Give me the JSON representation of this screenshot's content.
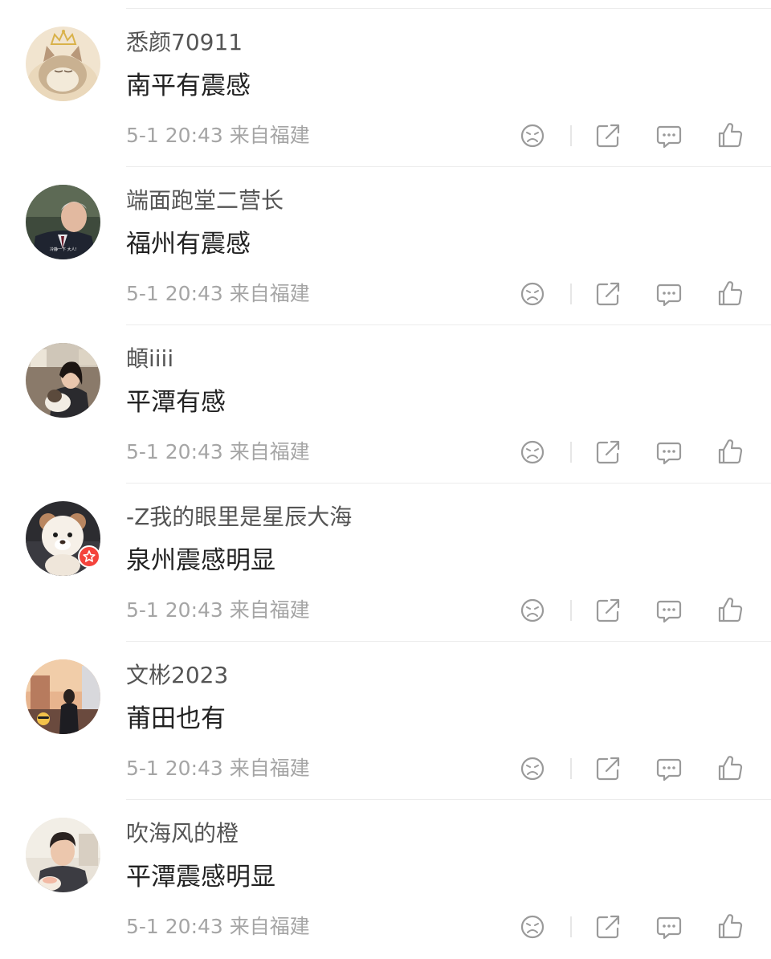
{
  "colors": {
    "username": "#555555",
    "content": "#222222",
    "meta": "#a5a5a5",
    "icon": "#9a9a9a",
    "badge": "#f4433c",
    "divider": "#ececec"
  },
  "comments": [
    {
      "username": "悉颜70911",
      "content": "南平有震感",
      "meta": "5-1 20:43 来自福建",
      "avatar": "cat-with-crown-avatar"
    },
    {
      "username": "端面跑堂二营长",
      "content": "福州有震感",
      "meta": "5-1 20:43 来自福建",
      "avatar": "man-in-suit-avatar",
      "avatar_caption": "冷静一下 大人!"
    },
    {
      "username": "頔iiii",
      "content": "平潭有感",
      "meta": "5-1 20:43 来自福建",
      "avatar": "girl-holding-dog-avatar"
    },
    {
      "username": "-Z我的眼里是星辰大海",
      "content": "泉州震感明显",
      "meta": "5-1 20:43 来自福建",
      "avatar": "plush-bear-avatar",
      "badge": "star-badge-icon"
    },
    {
      "username": "文彬2023",
      "content": "莆田也有",
      "meta": "5-1 20:43 来自福建",
      "avatar": "person-at-sunset-avatar"
    },
    {
      "username": "吹海风的橙",
      "content": "平潭震感明显",
      "meta": "5-1 20:43 来自福建",
      "avatar": "young-man-avatar"
    }
  ],
  "actions": [
    "dislike-icon",
    "share-icon",
    "reply-icon",
    "like-icon"
  ]
}
